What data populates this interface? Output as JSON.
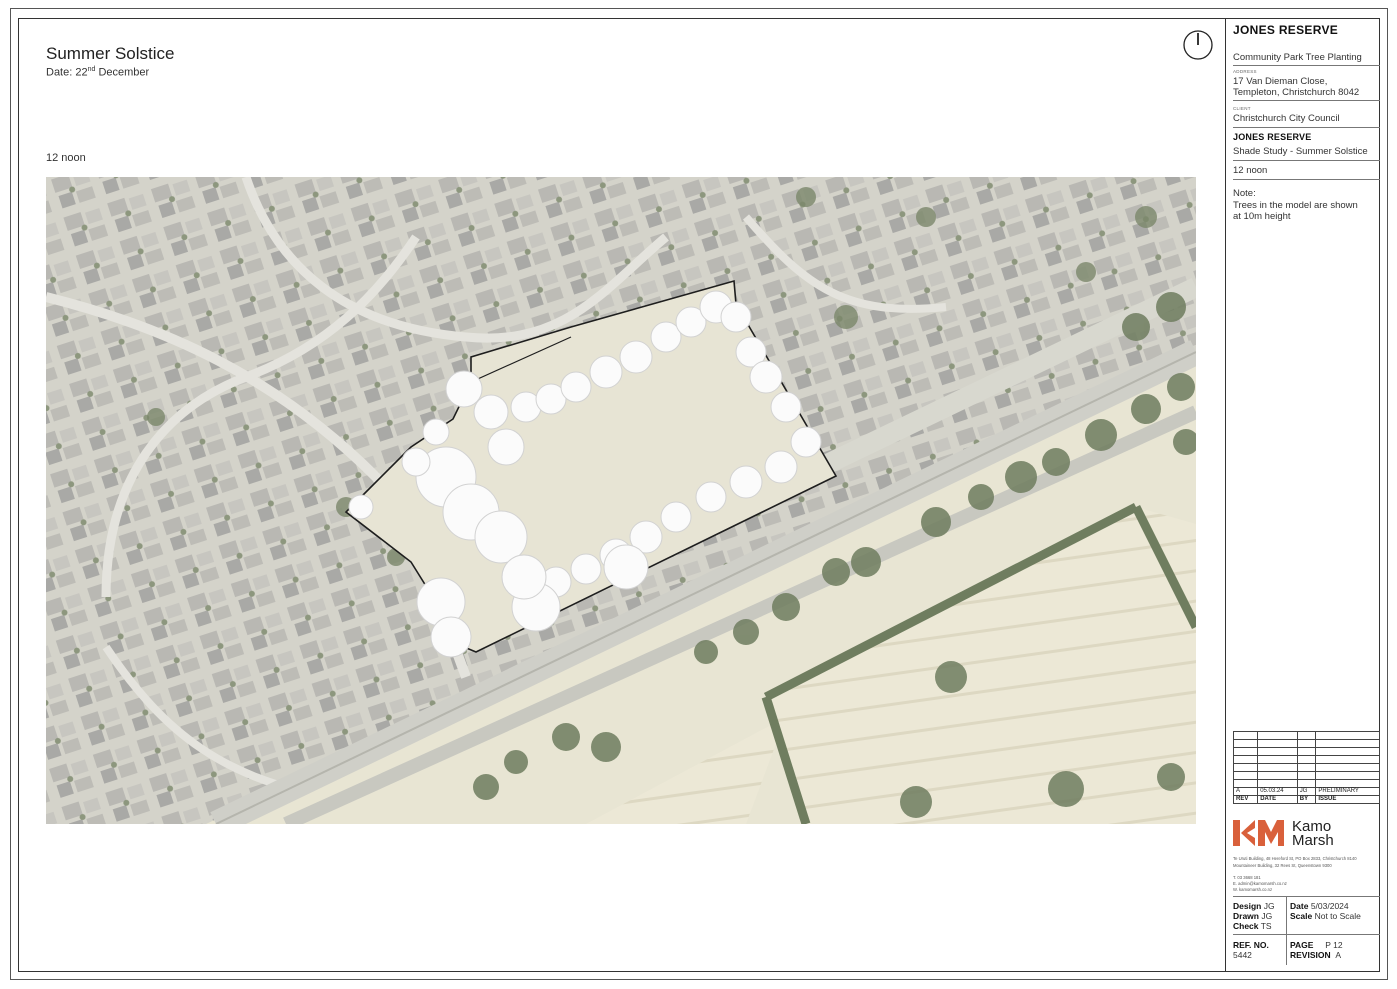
{
  "drawing": {
    "title": "Summer Solstice",
    "date_prefix": "Date: 22",
    "date_sup": "nd",
    "date_suffix": " December",
    "time_label": "12 noon"
  },
  "title_block": {
    "project": "JONES RESERVE",
    "project_desc": "Community Park Tree Planting",
    "address_caption": "ADDRESS",
    "address_line1": "17 Van Dieman Close,",
    "address_line2": "Templeton, Christchurch 8042",
    "client_caption": "CLIENT",
    "client": "Christchurch City Council",
    "sheet_project": "JONES RESERVE",
    "sheet_title": "Shade Study - Summer Solstice",
    "sheet_time": "12 noon",
    "note_label": "Note:",
    "note_line1": "Trees in the model are shown",
    "note_line2": "at 10m height"
  },
  "revisions": {
    "headers": [
      "REV",
      "DATE",
      "BY",
      "ISSUE"
    ],
    "rows": [
      [
        "A",
        "05.03.24",
        "JG",
        "PRELIMINARY"
      ]
    ]
  },
  "company": {
    "name_line1": "Kamo",
    "name_line2": "Marsh",
    "brand_color": "#d9603b",
    "address_line1": "Te Uruti Building, 48 Hereford St, PO Box 2833, Christchurch 8140",
    "address_line2": "Mountaineer Building, 32 Rees St, Queenstown 9300",
    "phone": "T. 03 3668 181",
    "email": "E. admin@kamomarsh.co.nz",
    "web": "W. kamomarsh.co.nz"
  },
  "sheet_info": {
    "design_label": "Design",
    "design": "JG",
    "drawn_label": "Drawn",
    "drawn": "JG",
    "check_label": "Check",
    "check": "TS",
    "date_label": "Date",
    "date": "5/03/2024",
    "scale_label": "Scale",
    "scale": "Not to Scale",
    "ref_label": "REF. NO.",
    "ref": "5442",
    "page_label": "PAGE",
    "page": "P 12",
    "revision_label": "REVISION",
    "revision": "A"
  },
  "colors": {
    "aerial_base": "#dcdcd2",
    "vegetation": "#6f7d5f",
    "reserve_grass": "#e7e4d4",
    "tree_canopy": "#fbfbfb",
    "boundary": "#1e1e1e"
  },
  "icons": {
    "north_arrow": "north-arrow-icon"
  }
}
